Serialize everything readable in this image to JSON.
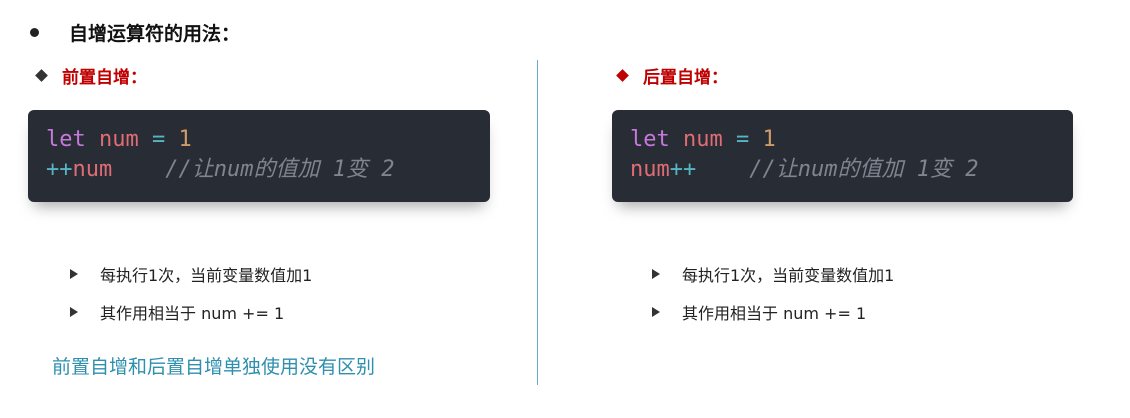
{
  "heading": "自增运算符的用法：",
  "left": {
    "title": "前置自增：",
    "code": {
      "line1": {
        "kw": "let",
        "var": "num",
        "op": "=",
        "num": "1"
      },
      "line2": {
        "op": "++",
        "var": "num",
        "comment": "//让num的值加 1变 2"
      }
    },
    "bullets": [
      "每执行1次，当前变量数值加1",
      "其作用相当于 num += 1"
    ]
  },
  "right": {
    "title": "后置自增：",
    "code": {
      "line1": {
        "kw": "let",
        "var": "num",
        "op": "=",
        "num": "1"
      },
      "line2": {
        "var": "num",
        "op": "++",
        "comment": "//让num的值加 1变 2"
      }
    },
    "bullets": [
      "每执行1次，当前变量数值加1",
      "其作用相当于 num += 1"
    ]
  },
  "note": "前置自增和后置自增单独使用没有区别",
  "colors": {
    "accent_red": "#c00000",
    "note_blue": "#2e8fae",
    "code_bg": "#282c34"
  }
}
